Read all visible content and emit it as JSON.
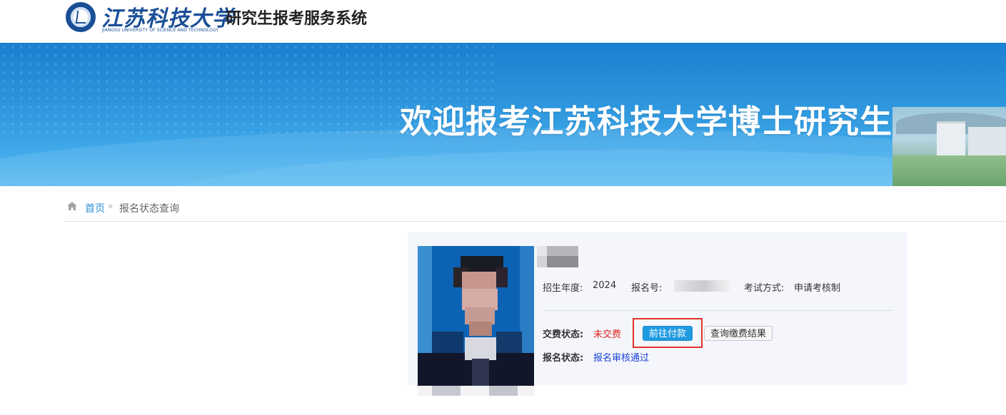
{
  "header": {
    "logo_cn": "江苏科技大学",
    "logo_en": "JIANGSU UNIVERSITY OF SCIENCE AND TECHNOLOGY",
    "system_title": "研究生报考服务系统"
  },
  "banner": {
    "title": "欢迎报考江苏科技大学博士研究生"
  },
  "breadcrumb": {
    "home": "首页",
    "separator": "»",
    "current": "报名状态查询"
  },
  "profile": {
    "year_label": "招生年度:",
    "year_value": "2024",
    "regno_label": "报名号:",
    "exam_label": "考试方式:",
    "exam_value": "申请考核制",
    "pay_status_label": "交费状态:",
    "pay_status_value": "未交费",
    "pay_button": "前往付款",
    "query_button": "查询缴费结果",
    "reg_status_label": "报名状态:",
    "reg_status_value": "报名审核通过"
  },
  "colors": {
    "accent": "#1e9ae0",
    "unpaid": "#e0261d",
    "approved": "#1a3fd6",
    "highlight_box": "#e5312b"
  }
}
